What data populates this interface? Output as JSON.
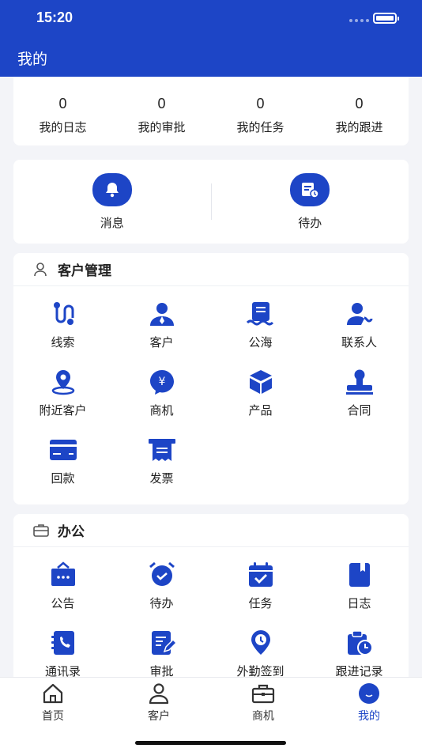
{
  "status_bar": {
    "time": "15:20"
  },
  "header": {
    "title": "我的"
  },
  "stats": [
    {
      "value": "0",
      "label": "我的日志"
    },
    {
      "value": "0",
      "label": "我的审批"
    },
    {
      "value": "0",
      "label": "我的任务"
    },
    {
      "value": "0",
      "label": "我的跟进"
    }
  ],
  "quick": [
    {
      "label": "消息",
      "icon": "bell-icon"
    },
    {
      "label": "待办",
      "icon": "todo-icon"
    }
  ],
  "customer_section": {
    "title": "客户管理",
    "items": [
      {
        "label": "线索",
        "icon": "lead-icon"
      },
      {
        "label": "客户",
        "icon": "customer-icon"
      },
      {
        "label": "公海",
        "icon": "public-sea-icon"
      },
      {
        "label": "联系人",
        "icon": "contact-icon"
      },
      {
        "label": "附近客户",
        "icon": "location-icon"
      },
      {
        "label": "商机",
        "icon": "business-icon"
      },
      {
        "label": "产品",
        "icon": "product-icon"
      },
      {
        "label": "合同",
        "icon": "contract-stamp-icon"
      },
      {
        "label": "回款",
        "icon": "card-icon"
      },
      {
        "label": "发票",
        "icon": "invoice-icon"
      }
    ]
  },
  "office_section": {
    "title": "办公",
    "items": [
      {
        "label": "公告",
        "icon": "notice-icon"
      },
      {
        "label": "待办",
        "icon": "alarm-clock-icon"
      },
      {
        "label": "任务",
        "icon": "calendar-check-icon"
      },
      {
        "label": "日志",
        "icon": "book-icon"
      },
      {
        "label": "通讯录",
        "icon": "phone-book-icon"
      },
      {
        "label": "审批",
        "icon": "approval-icon"
      },
      {
        "label": "外勤签到",
        "icon": "clock-pin-icon"
      },
      {
        "label": "跟进记录",
        "icon": "followup-icon"
      }
    ]
  },
  "tabbar": [
    {
      "label": "首页",
      "icon": "home-icon"
    },
    {
      "label": "客户",
      "icon": "user-icon"
    },
    {
      "label": "商机",
      "icon": "briefcase-icon"
    },
    {
      "label": "我的",
      "icon": "profile-icon",
      "active": true
    }
  ],
  "colors": {
    "primary": "#1d45c6",
    "background": "#f3f4f8"
  }
}
